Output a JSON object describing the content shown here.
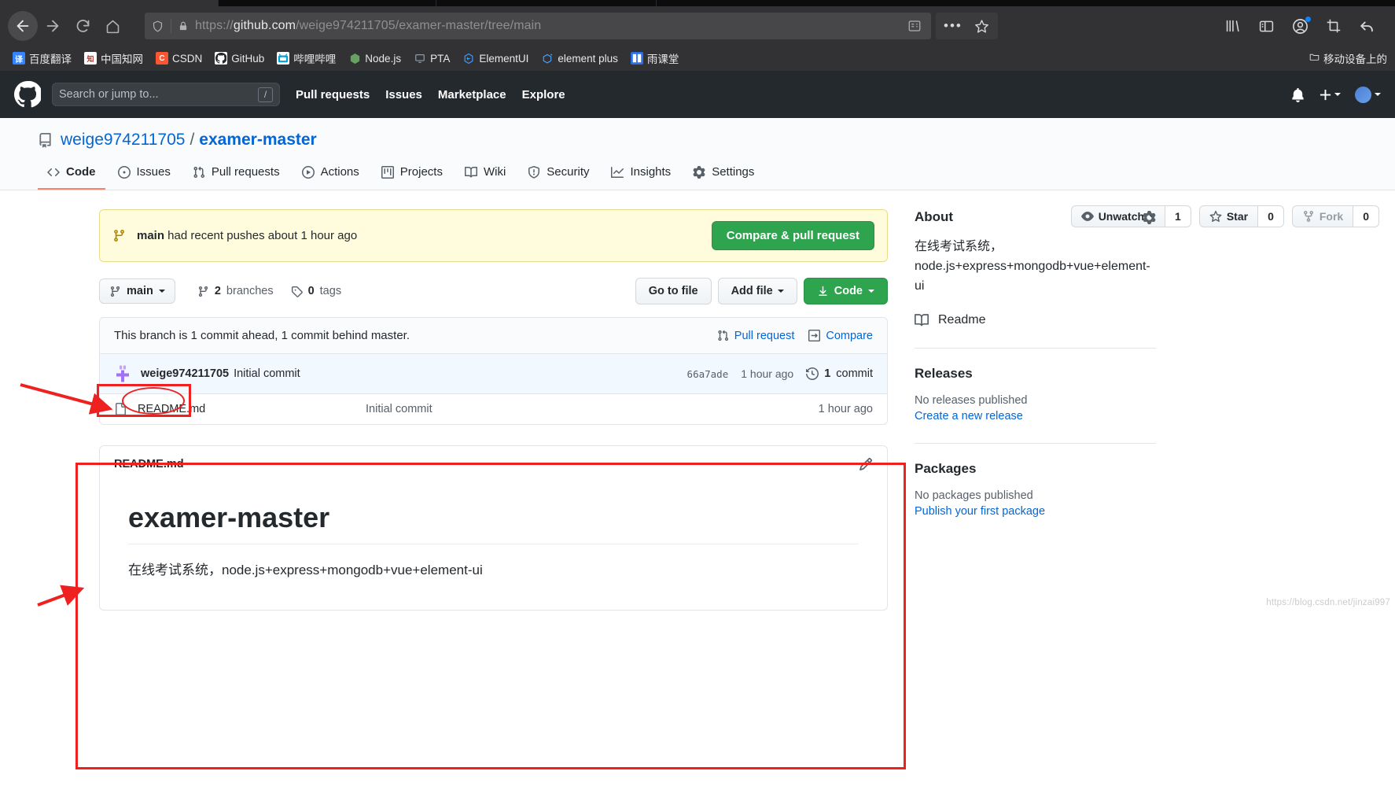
{
  "browser": {
    "name": "firefox",
    "url_prefix": "https://",
    "url_domain": "github.com",
    "url_path": "/weige974211705/examer-master/tree/main",
    "nav": {
      "back": "back-arrow",
      "forward": "forward-arrow",
      "reload": "reload",
      "home": "home"
    },
    "urlbar_icons": [
      "shield-icon",
      "lock-icon",
      "reader-icon",
      "more-icon",
      "bookmark-star-icon"
    ],
    "toolbar_icons": [
      "library-icon",
      "sidebar-icon",
      "account-icon",
      "screenshot-icon",
      "undo-icon"
    ],
    "bookmarks": [
      {
        "label": "百度翻译",
        "favicon_text": "译",
        "favicon_color": "#3385ff"
      },
      {
        "label": "中国知网",
        "favicon_text": "知",
        "favicon_color": "#ffffff"
      },
      {
        "label": "CSDN",
        "favicon_text": "C",
        "favicon_color": "#fc5531"
      },
      {
        "label": "GitHub",
        "favicon_text": "",
        "favicon_color": "#ffffff"
      },
      {
        "label": "哔哩哔哩",
        "favicon_text": "",
        "favicon_color": "#ffffff"
      },
      {
        "label": "Node.js",
        "favicon_text": "",
        "favicon_color": "#68a063"
      },
      {
        "label": "PTA",
        "favicon_text": "",
        "favicon_color": "#8a9aa8"
      },
      {
        "label": "ElementUI",
        "favicon_text": "",
        "favicon_color": "#409eff"
      },
      {
        "label": "element plus",
        "favicon_text": "",
        "favicon_color": "#409eff"
      },
      {
        "label": "雨课堂",
        "favicon_text": "",
        "favicon_color": "#2b6fe8"
      }
    ],
    "bookmarks_overflow": "移动设备上的"
  },
  "github": {
    "header": {
      "logo": "github-mark-icon",
      "search_placeholder": "Search or jump to...",
      "search_shortcut": "/",
      "nav": [
        "Pull requests",
        "Issues",
        "Marketplace",
        "Explore"
      ],
      "bell": "notifications-icon",
      "plus": "new-menu-icon",
      "avatar": "user-avatar"
    },
    "repo": {
      "owner": "weige974211705",
      "separator": "/",
      "name": "examer-master",
      "actions": [
        {
          "label": "Unwatch",
          "count": "1",
          "icon": "eye-icon",
          "has_caret": true
        },
        {
          "label": "Star",
          "count": "0",
          "icon": "star-icon",
          "has_caret": false
        },
        {
          "label": "Fork",
          "count": "0",
          "icon": "fork-icon",
          "has_caret": false
        }
      ],
      "tabs": [
        {
          "label": "Code",
          "icon": "code-icon",
          "selected": true
        },
        {
          "label": "Issues",
          "icon": "issue-opened-icon",
          "selected": false
        },
        {
          "label": "Pull requests",
          "icon": "git-pull-request-icon",
          "selected": false
        },
        {
          "label": "Actions",
          "icon": "play-icon",
          "selected": false
        },
        {
          "label": "Projects",
          "icon": "project-icon",
          "selected": false
        },
        {
          "label": "Wiki",
          "icon": "book-icon",
          "selected": false
        },
        {
          "label": "Security",
          "icon": "shield-icon",
          "selected": false
        },
        {
          "label": "Insights",
          "icon": "graph-icon",
          "selected": false
        },
        {
          "label": "Settings",
          "icon": "gear-icon",
          "selected": false
        }
      ]
    },
    "notice": {
      "branch": "main",
      "text": " had recent pushes about 1 hour ago",
      "button": "Compare & pull request"
    },
    "branch_bar": {
      "current_branch": "main",
      "branches_count": "2",
      "branches_label": "branches",
      "tags_count": "0",
      "tags_label": "tags",
      "go_to_file": "Go to file",
      "add_file": "Add file",
      "code": "Code"
    },
    "compare_row": {
      "text": "This branch is 1 commit ahead, 1 commit behind master.",
      "pull_request": "Pull request",
      "compare": "Compare"
    },
    "latest_commit": {
      "author": "weige974211705",
      "message": "Initial commit",
      "sha": "66a7ade",
      "time": "1 hour ago",
      "commit_count": "1",
      "commit_label": "commit"
    },
    "files": [
      {
        "name": "README.md",
        "message": "Initial commit",
        "time": "1 hour ago",
        "icon": "file-icon"
      }
    ],
    "readme": {
      "filename": "README.md",
      "edit_icon": "pencil-icon",
      "heading": "examer-master",
      "paragraph": "在线考试系统，node.js+express+mongodb+vue+element-ui"
    },
    "sidebar": {
      "about_title": "About",
      "about_gear": "gear-icon",
      "description": "在线考试系统，node.js+express+mongodb+vue+element-ui",
      "readme_link": "Readme",
      "releases_title": "Releases",
      "releases_none": "No releases published",
      "releases_link": "Create a new release",
      "packages_title": "Packages",
      "packages_none": "No packages published",
      "packages_link": "Publish your first package"
    }
  },
  "watermark": "https://blog.csdn.net/jinzai997",
  "colors": {
    "accent_green": "#2ea44f",
    "link_blue": "#0366d6",
    "annotation_red": "#ee2020",
    "notice_yellow": "#fffbdd",
    "tab_underline": "#f9826c"
  }
}
